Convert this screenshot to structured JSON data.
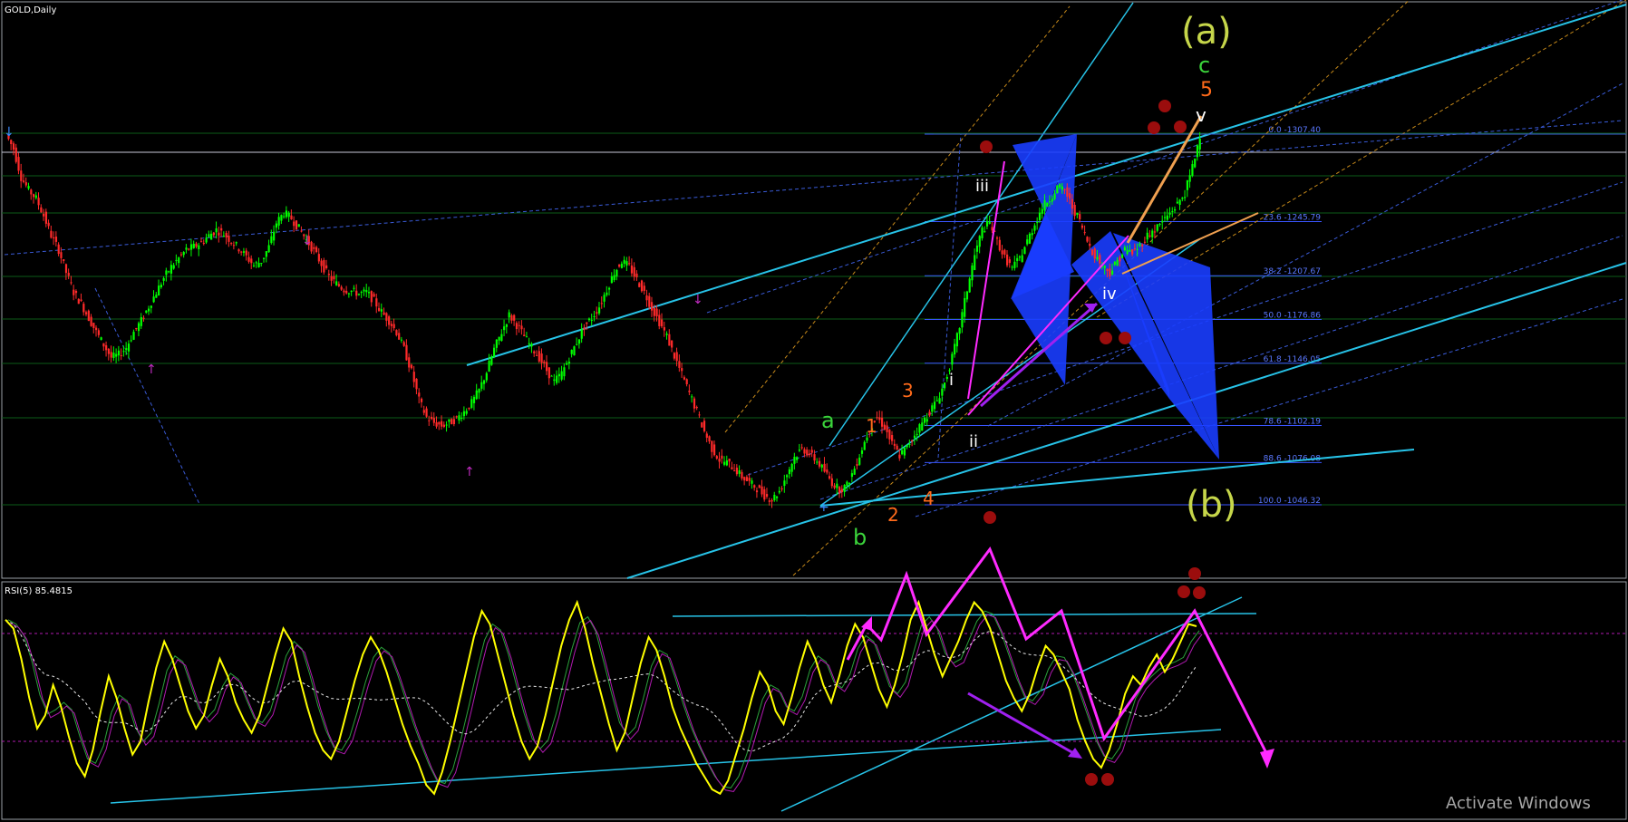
{
  "chart_data": [
    {
      "type": "line",
      "symbol_label": "GOLD,Daily",
      "series": [
        {
          "type": "candlestick",
          "x_unit": "bars",
          "price_path": [
            1307,
            1297,
            1277,
            1268,
            1262,
            1250,
            1236,
            1226,
            1210,
            1196,
            1188,
            1178,
            1168,
            1159,
            1150,
            1152,
            1157,
            1168,
            1176,
            1186,
            1196,
            1206,
            1214,
            1220,
            1226,
            1228,
            1231,
            1236,
            1240,
            1237,
            1232,
            1227,
            1221,
            1215,
            1218,
            1228,
            1245,
            1252,
            1248,
            1241,
            1233,
            1225,
            1216,
            1207,
            1202,
            1198,
            1197,
            1195,
            1196,
            1190,
            1182,
            1176,
            1168,
            1156,
            1140,
            1120,
            1108,
            1104,
            1102,
            1104,
            1107,
            1112,
            1118,
            1127,
            1140,
            1156,
            1168,
            1180,
            1173,
            1165,
            1157,
            1150,
            1141,
            1133,
            1139,
            1150,
            1161,
            1172,
            1178,
            1186,
            1198,
            1210,
            1218,
            1214,
            1205,
            1196,
            1185,
            1175,
            1165,
            1151,
            1138,
            1125,
            1112,
            1098,
            1086,
            1078,
            1076,
            1072,
            1066,
            1062,
            1058,
            1053,
            1050,
            1056,
            1068,
            1080,
            1086,
            1082,
            1077,
            1070,
            1062,
            1057,
            1060,
            1072,
            1086,
            1100,
            1108,
            1101,
            1089,
            1081,
            1087,
            1096,
            1104,
            1112,
            1120,
            1132,
            1150,
            1172,
            1198,
            1222,
            1240,
            1245,
            1232,
            1220,
            1213,
            1220,
            1232,
            1244,
            1256,
            1262,
            1270,
            1268,
            1256,
            1246,
            1232,
            1222,
            1215,
            1210,
            1218,
            1226,
            1224,
            1229,
            1236,
            1240,
            1246,
            1252,
            1258,
            1266,
            1284,
            1307
          ]
        }
      ],
      "fib_levels": [
        "0.0 -1307.40",
        "23.6 -1245.79",
        "38.2 -1207.67",
        "50.0 -1176.86",
        "61.8 -1146.05",
        "78.6 -1102.19",
        "88.6 -1076.08",
        "100.0 -1046.32"
      ],
      "wave_labels": [
        "(a)",
        "c",
        "5",
        "v",
        "iii",
        "iv",
        "i",
        "ii",
        "3",
        "1",
        "a",
        "2",
        "4",
        "b",
        "(b)"
      ]
    },
    {
      "type": "line",
      "indicator_label": "RSI(5) 85.4815",
      "ylim": [
        0,
        100
      ],
      "levels": [
        70,
        30
      ],
      "series": [
        {
          "name": "",
          "values": [
            88,
            84,
            70,
            52,
            38,
            44,
            58,
            48,
            34,
            22,
            16,
            28,
            46,
            62,
            52,
            38,
            26,
            32,
            50,
            66,
            78,
            70,
            58,
            46,
            38,
            44,
            58,
            70,
            62,
            50,
            42,
            36,
            44,
            58,
            72,
            84,
            78,
            62,
            48,
            36,
            28,
            24,
            32,
            46,
            60,
            72,
            80,
            74,
            64,
            52,
            40,
            30,
            22,
            12,
            8,
            18,
            32,
            48,
            64,
            80,
            92,
            86,
            72,
            58,
            44,
            32,
            24,
            30,
            44,
            60,
            76,
            88,
            96,
            84,
            68,
            54,
            40,
            28,
            36,
            52,
            68,
            80,
            74,
            62,
            48,
            38,
            30,
            22,
            16,
            10,
            8,
            14,
            26,
            38,
            52,
            64,
            58,
            46,
            40,
            52,
            66,
            78,
            70,
            58,
            50,
            62,
            76,
            86,
            80,
            68,
            56,
            48,
            58,
            72,
            88,
            96,
            84,
            72,
            62,
            70,
            78,
            88,
            96,
            92,
            84,
            72,
            60,
            52,
            46,
            54,
            66,
            76,
            72,
            64,
            56,
            42,
            32,
            24,
            20,
            28,
            40,
            54,
            62,
            58,
            66,
            72,
            64,
            70,
            78,
            86,
            85
          ]
        }
      ]
    }
  ],
  "watermark": "Activate Windows",
  "colors": {
    "bull": "#00ff00",
    "bear": "#ff2a2a",
    "rsi": "#ffff00",
    "cyan": "#27c3e8",
    "magenta": "#ff2aff",
    "fib": "#3a55ff",
    "grid": "#0d5d18",
    "label_green": "#3bd43b",
    "label_orange": "#ff6a1a",
    "label_olive": "#c6d64a",
    "marker": "#9b0d0d"
  }
}
